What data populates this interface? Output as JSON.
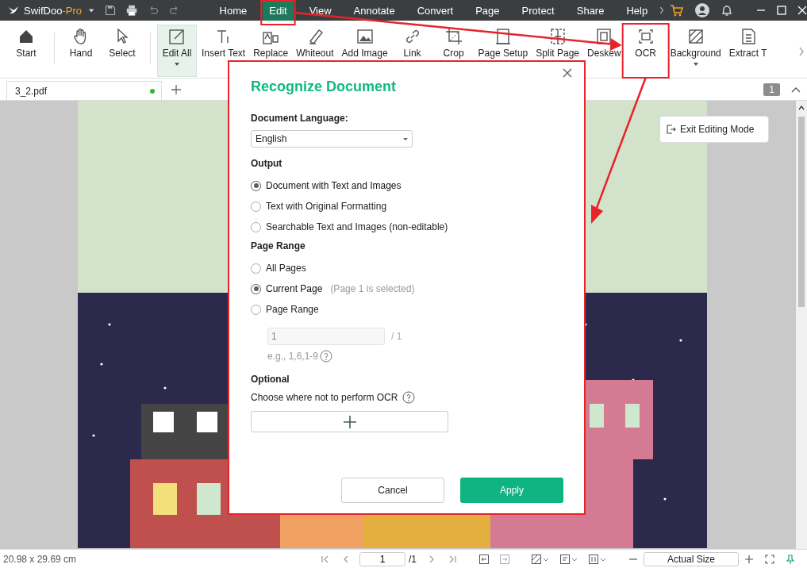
{
  "app": {
    "name": "SwifDoo",
    "suffix": "-Pro"
  },
  "menu": [
    {
      "label": "Home",
      "selected": false
    },
    {
      "label": "Edit",
      "selected": true
    },
    {
      "label": "View",
      "selected": false
    },
    {
      "label": "Annotate",
      "selected": false
    },
    {
      "label": "Convert",
      "selected": false
    },
    {
      "label": "Page",
      "selected": false
    },
    {
      "label": "Protect",
      "selected": false
    },
    {
      "label": "Share",
      "selected": false
    },
    {
      "label": "Help",
      "selected": false
    }
  ],
  "toolbar": [
    {
      "label": "Start",
      "selected": false,
      "has_menu": false
    },
    {
      "label": "Hand",
      "selected": false,
      "has_menu": false
    },
    {
      "label": "Select",
      "selected": false,
      "has_menu": false
    },
    {
      "label": "Edit All",
      "selected": true,
      "has_menu": true
    },
    {
      "label": "Insert Text",
      "selected": false,
      "has_menu": false
    },
    {
      "label": "Replace",
      "selected": false,
      "has_menu": false
    },
    {
      "label": "Whiteout",
      "selected": false,
      "has_menu": false
    },
    {
      "label": "Add Image",
      "selected": false,
      "has_menu": false
    },
    {
      "label": "Link",
      "selected": false,
      "has_menu": false
    },
    {
      "label": "Crop",
      "selected": false,
      "has_menu": false
    },
    {
      "label": "Page Setup",
      "selected": false,
      "has_menu": false
    },
    {
      "label": "Split Page",
      "selected": false,
      "has_menu": false
    },
    {
      "label": "Deskew",
      "selected": false,
      "has_menu": false
    },
    {
      "label": "OCR",
      "selected": false,
      "has_menu": false
    },
    {
      "label": "Background",
      "selected": false,
      "has_menu": true
    },
    {
      "label": "Extract T",
      "selected": false,
      "has_menu": false
    }
  ],
  "tabs": [
    {
      "label": "3_2.pdf",
      "selected": true,
      "saved": true
    }
  ],
  "page_badge": "1",
  "exit_editing": "Exit Editing Mode",
  "dialog": {
    "title": "Recognize Document",
    "language_label": "Document Language:",
    "language": "English",
    "output_label": "Output",
    "output_options": [
      {
        "label": "Document with Text and Images",
        "selected": true
      },
      {
        "label": "Text with Original Formatting",
        "selected": false
      },
      {
        "label": "Searchable Text and Images (non-editable)",
        "selected": false
      }
    ],
    "range_label": "Page Range",
    "range_options": [
      {
        "label": "All Pages",
        "selected": false
      },
      {
        "label": "Current Page",
        "note": "(Page 1 is selected)",
        "selected": true
      },
      {
        "label": "Page Range",
        "selected": false
      }
    ],
    "range_value": "1",
    "range_total": "/ 1",
    "range_hint": "e.g., 1,6,1-9",
    "optional_label": "Optional",
    "optional_text": "Choose where not to perform OCR",
    "cancel": "Cancel",
    "apply": "Apply"
  },
  "status_bar": {
    "size": "20.98 x 29.69 cm",
    "page": "1",
    "total": "/1",
    "zoom": "Actual Size"
  }
}
